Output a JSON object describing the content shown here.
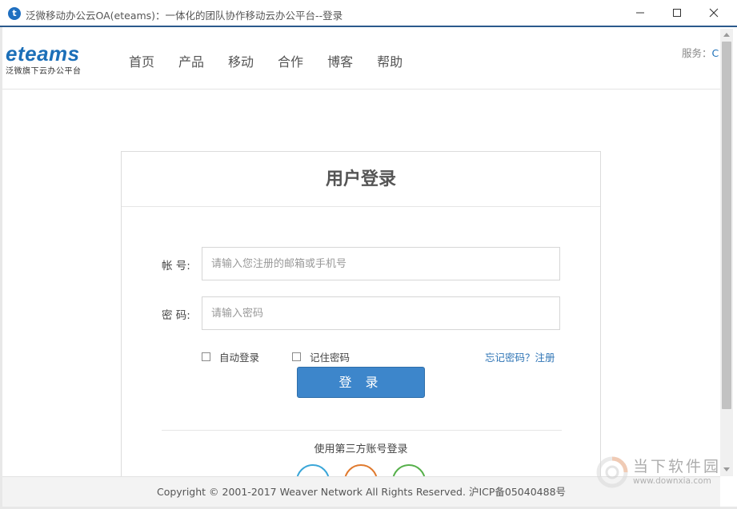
{
  "window": {
    "title": "泛微移动办公云OA(eteams)：一体化的团队协作移动云办公平台--登录",
    "app_icon_glyph": "t"
  },
  "header": {
    "logo_text": "eteams",
    "logo_sub": "泛微旗下云办公平台",
    "nav": [
      {
        "label": "首页"
      },
      {
        "label": "产品"
      },
      {
        "label": "移动"
      },
      {
        "label": "合作"
      },
      {
        "label": "博客"
      },
      {
        "label": "帮助"
      }
    ],
    "service_label": "服务：",
    "service_tail": "C"
  },
  "login": {
    "title": "用户登录",
    "account_label": "帐 号:",
    "account_placeholder": "请输入您注册的邮箱或手机号",
    "account_value": "",
    "password_label": "密 码:",
    "password_placeholder": "请输入密码",
    "password_value": "",
    "auto_login_label": "自动登录",
    "auto_login_checked": false,
    "remember_label": "记住密码",
    "remember_checked": false,
    "forgot_label": "忘记密码？",
    "register_label": "注册",
    "submit_label": "登 录",
    "third_party_label": "使用第三方账号登录",
    "social_icons": [
      {
        "icon": "social-icon-1",
        "color": "#3aa6d8"
      },
      {
        "icon": "social-icon-2",
        "color": "#e07a2e"
      },
      {
        "icon": "social-icon-3",
        "color": "#56b04a"
      }
    ]
  },
  "footer": {
    "copyright": "Copyright © 2001-2017 Weaver Network All Rights Reserved. 沪ICP备05040488号"
  },
  "watermark": {
    "title": "当下软件园",
    "url": "www.downxia.com"
  },
  "colors": {
    "brand": "#1c6fb8",
    "button": "#3d86cb",
    "link": "#2e74b5"
  }
}
